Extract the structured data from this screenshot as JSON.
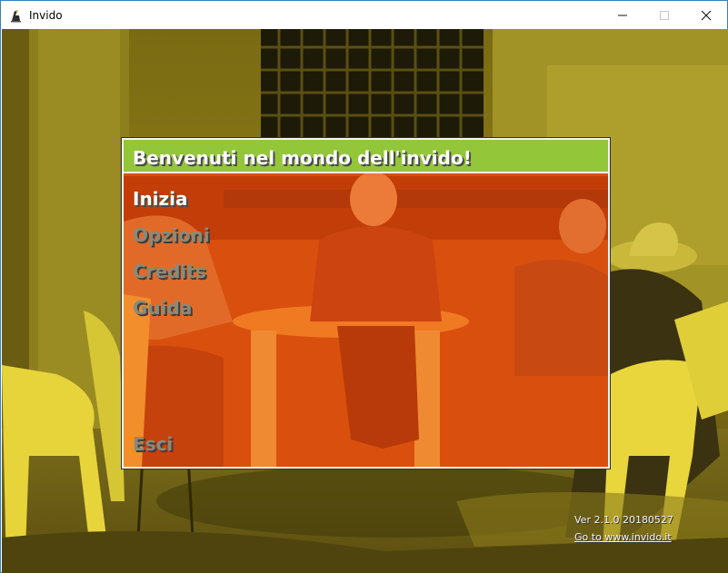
{
  "window": {
    "title": "Invido",
    "icon": "invido-app-icon",
    "controls": {
      "minimize": "—",
      "maximize": "☐",
      "close": "✕"
    }
  },
  "panel": {
    "title": "Benvenuti nel mondo dell'invido!",
    "menu": [
      {
        "label": "Inizia",
        "state": "active"
      },
      {
        "label": "Opzioni",
        "state": "inactive"
      },
      {
        "label": "Credits",
        "state": "inactive"
      },
      {
        "label": "Guida",
        "state": "inactive"
      },
      {
        "label": "Esci",
        "state": "inactive"
      }
    ]
  },
  "footer": {
    "version": "Ver 2.1.0 20180527",
    "link": "Go to www.invido.it"
  },
  "colors": {
    "header_green": "#94c639",
    "panel_overlay": "#eb460a",
    "photo_tint": "#c8b020"
  }
}
